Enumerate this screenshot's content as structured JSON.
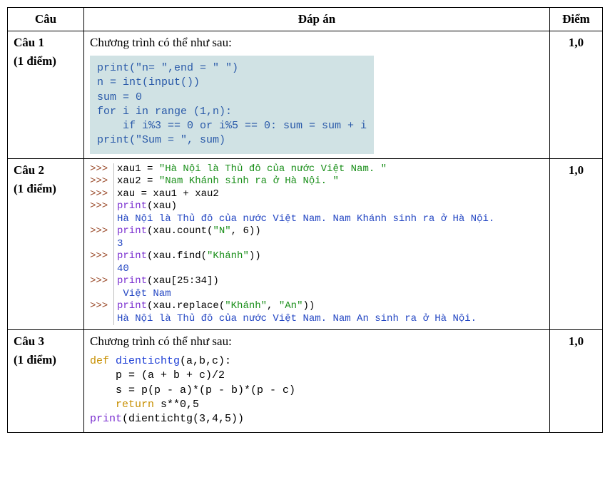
{
  "headers": {
    "cau": "Câu",
    "dapan": "Đáp án",
    "diem": "Điểm"
  },
  "q1": {
    "title": "Câu 1",
    "sub": "(1 điểm)",
    "intro": "Chương trình có thể như sau:",
    "code": "print(\"n= \",end = \" \")\nn = int(input())\nsum = 0\nfor i in range (1,n):\n    if i%3 == 0 or i%5 == 0: sum = sum + i\nprint(\"Sum = \", sum)",
    "score": "1,0"
  },
  "q2": {
    "title": "Câu 2",
    "sub": "(1 điểm)",
    "score": "1,0",
    "lines": [
      {
        "prompt": ">>>",
        "parts": [
          [
            "plain",
            "xau1 = "
          ],
          [
            "str",
            "\"Hà Nội là Thủ đô của nước Việt Nam. \""
          ]
        ]
      },
      {
        "prompt": ">>>",
        "parts": [
          [
            "plain",
            "xau2 = "
          ],
          [
            "str",
            "\"Nam Khánh sinh ra ở Hà Nội. \""
          ]
        ]
      },
      {
        "prompt": ">>>",
        "parts": [
          [
            "plain",
            "xau = xau1 + xau2"
          ]
        ]
      },
      {
        "prompt": ">>>",
        "parts": [
          [
            "fn",
            "print"
          ],
          [
            "plain",
            "(xau)"
          ]
        ]
      },
      {
        "prompt": "",
        "parts": [
          [
            "out",
            "Hà Nội là Thủ đô của nước Việt Nam. Nam Khánh sinh ra ở Hà Nội."
          ]
        ]
      },
      {
        "prompt": ">>>",
        "parts": [
          [
            "fn",
            "print"
          ],
          [
            "plain",
            "(xau.count("
          ],
          [
            "str",
            "\"N\""
          ],
          [
            "plain",
            ", 6))"
          ]
        ]
      },
      {
        "prompt": "",
        "parts": [
          [
            "out",
            "3"
          ]
        ]
      },
      {
        "prompt": ">>>",
        "parts": [
          [
            "fn",
            "print"
          ],
          [
            "plain",
            "(xau.find("
          ],
          [
            "str",
            "\"Khánh\""
          ],
          [
            "plain",
            "))"
          ]
        ]
      },
      {
        "prompt": "",
        "parts": [
          [
            "out",
            "40"
          ]
        ]
      },
      {
        "prompt": ">>>",
        "parts": [
          [
            "fn",
            "print"
          ],
          [
            "plain",
            "(xau[25:34])"
          ]
        ]
      },
      {
        "prompt": "",
        "parts": [
          [
            "out",
            " Việt Nam"
          ]
        ]
      },
      {
        "prompt": ">>>",
        "parts": [
          [
            "fn",
            "print"
          ],
          [
            "plain",
            "(xau.replace("
          ],
          [
            "str",
            "\"Khánh\""
          ],
          [
            "plain",
            ", "
          ],
          [
            "str",
            "\"An\""
          ],
          [
            "plain",
            "))"
          ]
        ]
      },
      {
        "prompt": "",
        "parts": [
          [
            "out",
            "Hà Nội là Thủ đô của nước Việt Nam. Nam An sinh ra ở Hà Nội."
          ]
        ]
      }
    ]
  },
  "q3": {
    "title": "Câu 3",
    "sub": "(1 điểm)",
    "intro": "Chương trình có thể như sau:",
    "score": "1,0",
    "code_lines": [
      [
        [
          "kw-def",
          "def"
        ],
        [
          "plain",
          " "
        ],
        [
          "fn",
          "dientichtg"
        ],
        [
          "plain",
          "(a,b,c):"
        ]
      ],
      [
        [
          "plain",
          "    p = (a + b + c)/2"
        ]
      ],
      [
        [
          "plain",
          "    s = p(p - a)*(p - b)*(p - c)"
        ]
      ],
      [
        [
          "plain",
          "    "
        ],
        [
          "kw-ret",
          "return"
        ],
        [
          "plain",
          " s**0,5"
        ]
      ],
      [
        [
          "pr",
          "print"
        ],
        [
          "plain",
          "(dientichtg(3,4,5))"
        ]
      ]
    ]
  }
}
